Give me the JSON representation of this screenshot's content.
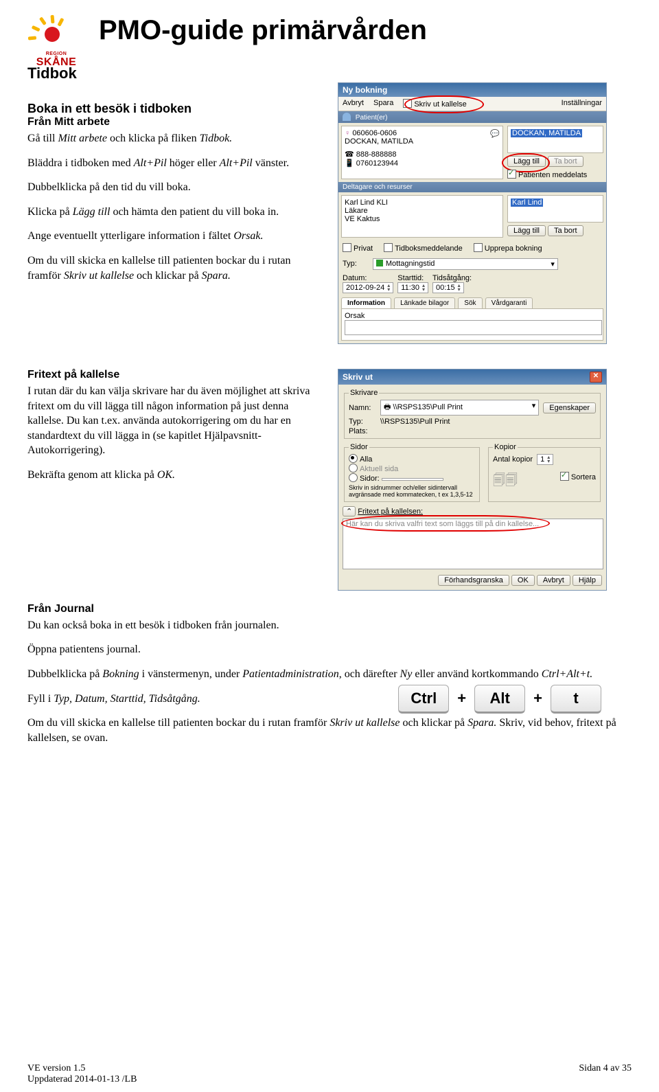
{
  "header": {
    "logo_brand_top": "REGION",
    "logo_brand": "SKÅNE",
    "main_title": "PMO-guide primärvården",
    "subtitle": "Tidbok"
  },
  "section1": {
    "heading": "Boka in ett besök i tidboken",
    "sub1": "Från Mitt arbete",
    "p1a": "Gå till ",
    "p1b": "Mitt arbete",
    "p1c": " och klicka på fliken ",
    "p1d": "Tidbok.",
    "p2a": "Bläddra i tidboken med ",
    "p2b": "Alt+Pil",
    "p2c": " höger eller ",
    "p2d": "Alt+Pil",
    "p2e": " vänster.",
    "p3": "Dubbelklicka på den tid du vill boka.",
    "p4a": "Klicka på ",
    "p4b": "Lägg till",
    "p4c": " och hämta den patient du vill boka in.",
    "p5a": "Ange eventuellt ytterligare information i fältet ",
    "p5b": "Orsak.",
    "p6a": "Om du vill skicka en kallelse till patienten bockar du i rutan framför ",
    "p6b": "Skriv ut kallelse",
    "p6c": " och klickar på ",
    "p6d": "Spara."
  },
  "ss1": {
    "title": "Ny bokning",
    "menu": {
      "avbryt": "Avbryt",
      "spara": "Spara",
      "skriv_ut": "Skriv ut kallelse",
      "install": "Inställningar"
    },
    "patienter": "Patient(er)",
    "pnr": "060606-0606",
    "pname": "DOCKAN, MATILDA",
    "pname2": "DOCKAN, MATILDA",
    "tel1": "888-888888",
    "tel2": "0760123944",
    "lagg_till": "Lägg till",
    "ta_bort": "Ta bort",
    "meddelats": "Patienten meddelats",
    "deltagare": "Deltagare och resurser",
    "res1": "Karl Lind  KLI",
    "res2": "Läkare",
    "res3": "VE Kaktus",
    "sel_res": "Karl Lind",
    "privat": "Privat",
    "tidboksmed": "Tidboksmeddelande",
    "upprepa": "Upprepa bokning",
    "typ_lbl": "Typ:",
    "typ_val": "Mottagningstid",
    "datum_lbl": "Datum:",
    "datum_val": "2012-09-24",
    "starttid_lbl": "Starttid:",
    "starttid_val": "11:30",
    "tidsatgang_lbl": "Tidsåtgång:",
    "tidsatgang_val": "00:15",
    "tabs": {
      "info": "Information",
      "lankade": "Länkade bilagor",
      "sok": "Sök",
      "vard": "Vårdgaranti"
    },
    "orsak_lbl": "Orsak"
  },
  "section2": {
    "heading": "Fritext på kallelse",
    "p1": "I rutan där du kan välja skrivare har du även möjlighet att skriva fritext om du vill lägga till någon information på just denna kallelse. Du kan t.ex. använda autokorrigering om du har en standardtext du vill lägga in (se kapitlet Hjälpavsnitt-Autokorrigering).",
    "p2a": "Bekräfta genom att klicka på ",
    "p2b": "OK."
  },
  "ss2": {
    "title": "Skriv ut",
    "skrivare_lbl": "Skrivare",
    "namn_lbl": "Namn:",
    "namn_val": "\\\\RSPS135\\Pull Print",
    "egenskaper": "Egenskaper",
    "typ_lbl": "Typ:",
    "typ_val": "\\\\RSPS135\\Pull Print",
    "plats_lbl": "Plats:",
    "sidor_lbl": "Sidor",
    "alla": "Alla",
    "aktuell": "Aktuell sida",
    "sidor_opt": "Sidor:",
    "sidor_help": "Skriv in sidnummer och/eller sidintervall avgränsade med kommatecken, t ex 1,3,5-12",
    "kopior_lbl": "Kopior",
    "antal_lbl": "Antal kopior",
    "antal_val": "1",
    "sortera": "Sortera",
    "fritext_exp": "Fritext på kallelsen:",
    "fritext_ph": "Här kan du skriva valfri text som läggs till på din kallelse...",
    "forhand": "Förhandsgranska",
    "ok": "OK",
    "avbryt": "Avbryt",
    "hjalp": "Hjälp"
  },
  "section3": {
    "heading": "Från Journal",
    "p1": "Du kan också boka in ett besök i tidboken från journalen.",
    "p2": "Öppna patientens journal.",
    "p3a": "Dubbelklicka på ",
    "p3b": "Bokning",
    "p3c": " i vänstermenyn, under ",
    "p3d": "Patientadministration",
    "p3e": ", och därefter ",
    "p3f": "Ny",
    "p3g": " eller använd kortkommando ",
    "p3h": "Ctrl+Alt+t.",
    "p4a": "Fyll i ",
    "p4b": "Typ, Datum, Starttid, Tidsåtgång.",
    "p5a": "Om du vill skicka en kallelse till patienten bockar du i rutan framför ",
    "p5b": "Skriv ut kallelse",
    "p5c": " och klickar på ",
    "p5d": "Spara.",
    "p5e": " Skriv, vid behov, fritext på kallelsen, se ovan."
  },
  "keys": {
    "ctrl": "Ctrl",
    "alt": "Alt",
    "t": "t",
    "plus": "+"
  },
  "footer": {
    "left1": "VE version 1.5",
    "left2": "Uppdaterad 2014-01-13 /LB",
    "right": "Sidan 4 av 35"
  }
}
